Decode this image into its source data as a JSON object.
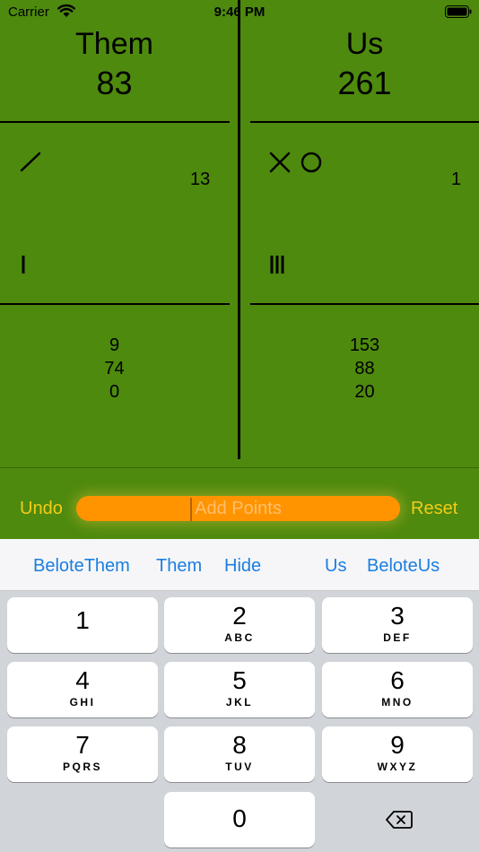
{
  "status_bar": {
    "carrier": "Carrier",
    "time": "9:46 PM"
  },
  "them": {
    "name": "Them",
    "score": "83",
    "tally_count": "13",
    "history": [
      "9",
      "74",
      "0"
    ]
  },
  "us": {
    "name": "Us",
    "score": "261",
    "tally_count": "1",
    "history": [
      "153",
      "88",
      "20"
    ]
  },
  "controls": {
    "undo": "Undo",
    "reset": "Reset",
    "placeholder": "Add Points"
  },
  "toolbar": {
    "belote_them": "BeloteThem",
    "them": "Them",
    "hide": "Hide",
    "us": "Us",
    "belote_us": "BeloteUs"
  },
  "keypad": {
    "k1": {
      "num": "1",
      "letters": ""
    },
    "k2": {
      "num": "2",
      "letters": "ABC"
    },
    "k3": {
      "num": "3",
      "letters": "DEF"
    },
    "k4": {
      "num": "4",
      "letters": "GHI"
    },
    "k5": {
      "num": "5",
      "letters": "JKL"
    },
    "k6": {
      "num": "6",
      "letters": "MNO"
    },
    "k7": {
      "num": "7",
      "letters": "PQRS"
    },
    "k8": {
      "num": "8",
      "letters": "TUV"
    },
    "k9": {
      "num": "9",
      "letters": "WXYZ"
    },
    "k0": {
      "num": "0"
    }
  },
  "colors": {
    "board": "#4e8a0e",
    "accent": "#f4cc16",
    "input": "#ff9400",
    "toolbar_link": "#1a7ee0"
  },
  "icons": {
    "wifi": "wifi-icon",
    "battery": "battery-icon",
    "delete": "backspace-icon"
  }
}
